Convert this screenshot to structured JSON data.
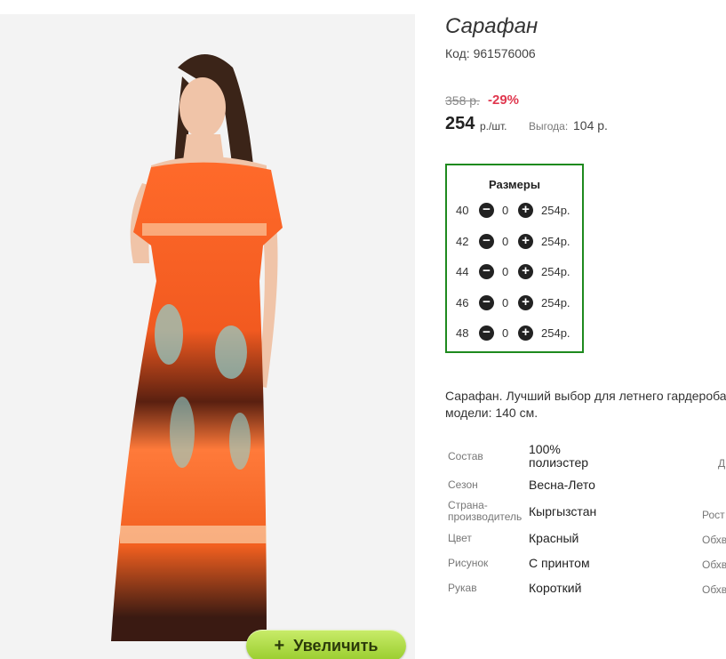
{
  "product": {
    "title": "Сарафан",
    "code": "Код: 961576006",
    "old_price": "358 р.",
    "discount": "-29%",
    "price": "254",
    "price_unit": "р./шт.",
    "savings_label": "Выгода:",
    "savings_value": "104 р."
  },
  "sizes": {
    "header": "Размеры",
    "rows": [
      {
        "size": "40",
        "qty": "0",
        "price": "254р."
      },
      {
        "size": "42",
        "qty": "0",
        "price": "254р."
      },
      {
        "size": "44",
        "qty": "0",
        "price": "254р."
      },
      {
        "size": "46",
        "qty": "0",
        "price": "254р."
      },
      {
        "size": "48",
        "qty": "0",
        "price": "254р."
      }
    ],
    "minus_icon": "minus-circle-icon",
    "plus_icon": "plus-circle-icon"
  },
  "description": {
    "line1": "Сарафан. Лучший выбор для летнего гардероба",
    "line2": "модели: 140 см."
  },
  "attributes": [
    {
      "label": "Состав",
      "value_line1": "100%",
      "value_line2": "полиэстер",
      "right": "Д"
    },
    {
      "label": "Сезон",
      "value": "Весна-Лето"
    },
    {
      "label_line1": "Страна-",
      "label_line2": "производитель",
      "value": "Кыргызстан",
      "right": "Рост"
    },
    {
      "label": "Цвет",
      "value": "Красный",
      "right": "Обхв"
    },
    {
      "label": "Рисунок",
      "value": "С принтом",
      "right": "Обхв"
    },
    {
      "label": "Рукав",
      "value": "Короткий",
      "right": "Обхв"
    }
  ],
  "zoom_button": {
    "label": "Увеличить",
    "icon": "plus-icon"
  },
  "colors": {
    "accent_green": "#1e8a1e",
    "discount_red": "#e0384f",
    "button_green": "#98cc2c"
  }
}
